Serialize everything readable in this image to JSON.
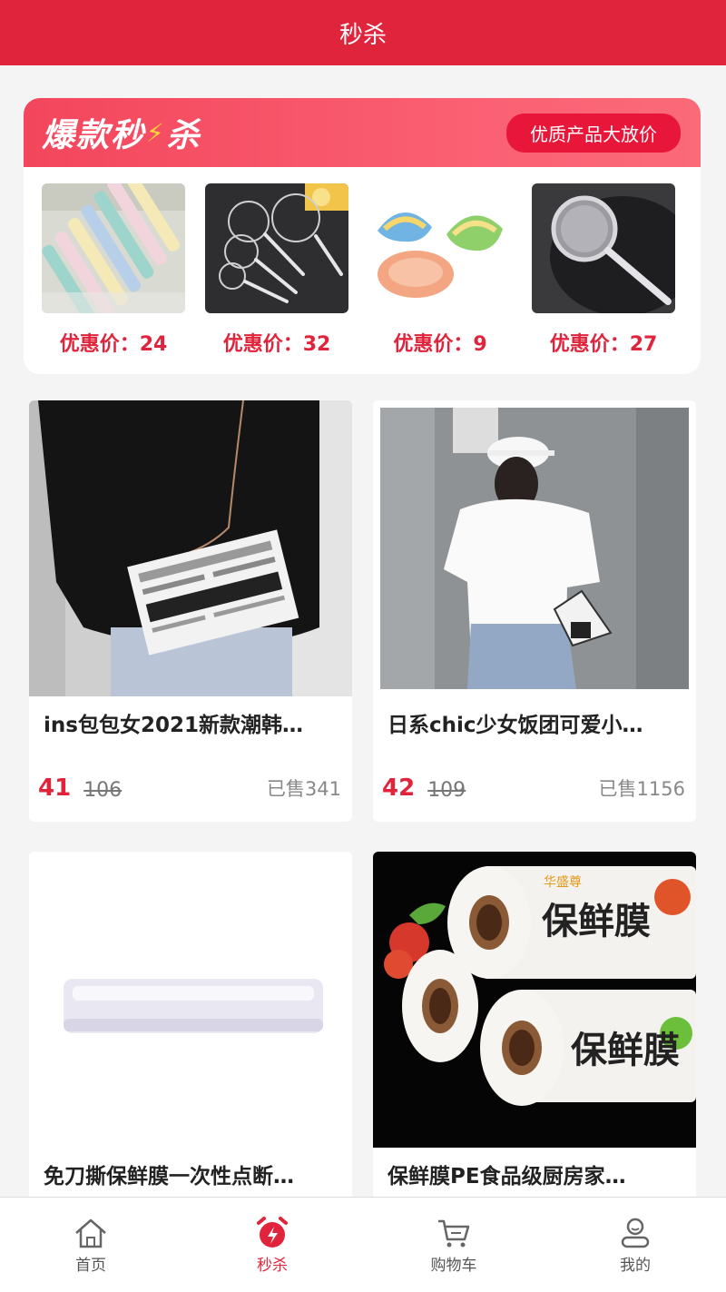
{
  "header": {
    "title": "秒杀"
  },
  "flash_sale": {
    "logo_text_a": "爆款秒",
    "logo_text_b": "杀",
    "tagline": "优质产品大放价",
    "items": [
      {
        "image": "toothbrush-set",
        "price_label": "优惠价：24"
      },
      {
        "image": "mesh-strainer-set",
        "price_label": "优惠价：32"
      },
      {
        "image": "dumpling-mold",
        "price_label": "优惠价：9"
      },
      {
        "image": "oil-strainer",
        "price_label": "优惠价：27"
      }
    ]
  },
  "products": [
    {
      "image": "newspaper-shoulder-bag",
      "title": "ins包包女2021新款潮韩…",
      "price": "41",
      "original_price": "106",
      "sold": "已售341"
    },
    {
      "image": "onigiri-crossbody-bag",
      "title": "日系chic少女饭团可爱小…",
      "price": "42",
      "original_price": "109",
      "sold": "已售1156"
    },
    {
      "image": "cling-film-roll-plain",
      "title": "免刀撕保鲜膜一次性点断…"
    },
    {
      "image": "cling-film-rolls-branded",
      "title": "保鲜膜PE食品级厨房家…",
      "brand_text": "华盛尊",
      "package_text": "保鲜膜"
    }
  ],
  "tabbar": [
    {
      "label": "首页",
      "icon": "home-icon",
      "active": false
    },
    {
      "label": "秒杀",
      "icon": "alarm-clock-icon",
      "active": true
    },
    {
      "label": "购物车",
      "icon": "cart-icon",
      "active": false
    },
    {
      "label": "我的",
      "icon": "profile-icon",
      "active": false
    }
  ],
  "colors": {
    "accent": "#e0243b",
    "background": "#f4f4f4"
  }
}
